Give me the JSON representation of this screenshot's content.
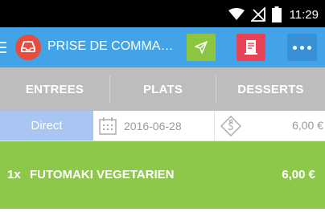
{
  "status_bar": {
    "time": "11:29",
    "icons": [
      "wifi-icon",
      "no-signal-icon",
      "battery-icon"
    ]
  },
  "app_bar": {
    "title": "PRISE DE COMMANDE",
    "actions": [
      {
        "icon": "send-icon",
        "color": "#8cc640"
      },
      {
        "icon": "receipt-icon",
        "color": "#e84357"
      },
      {
        "icon": "more-icon",
        "color": "#3a90d6"
      }
    ],
    "background": "#42a3e6",
    "logo_color": "#e74c3c"
  },
  "tabs": {
    "items": [
      {
        "label": "ENTREES",
        "selected": true
      },
      {
        "label": "PLATS",
        "selected": false
      },
      {
        "label": "DESSERTS",
        "selected": false
      }
    ],
    "background": "#bdbdbd"
  },
  "order": {
    "type": "Direct",
    "type_color": "#a9c6f3",
    "date": "2016-06-28",
    "total": "6,00 €"
  },
  "items": [
    {
      "quantity": "1x",
      "name": "FUTOMAKI VEGETARIEN",
      "price": "6,00 €",
      "color": "#8ec84a"
    }
  ]
}
